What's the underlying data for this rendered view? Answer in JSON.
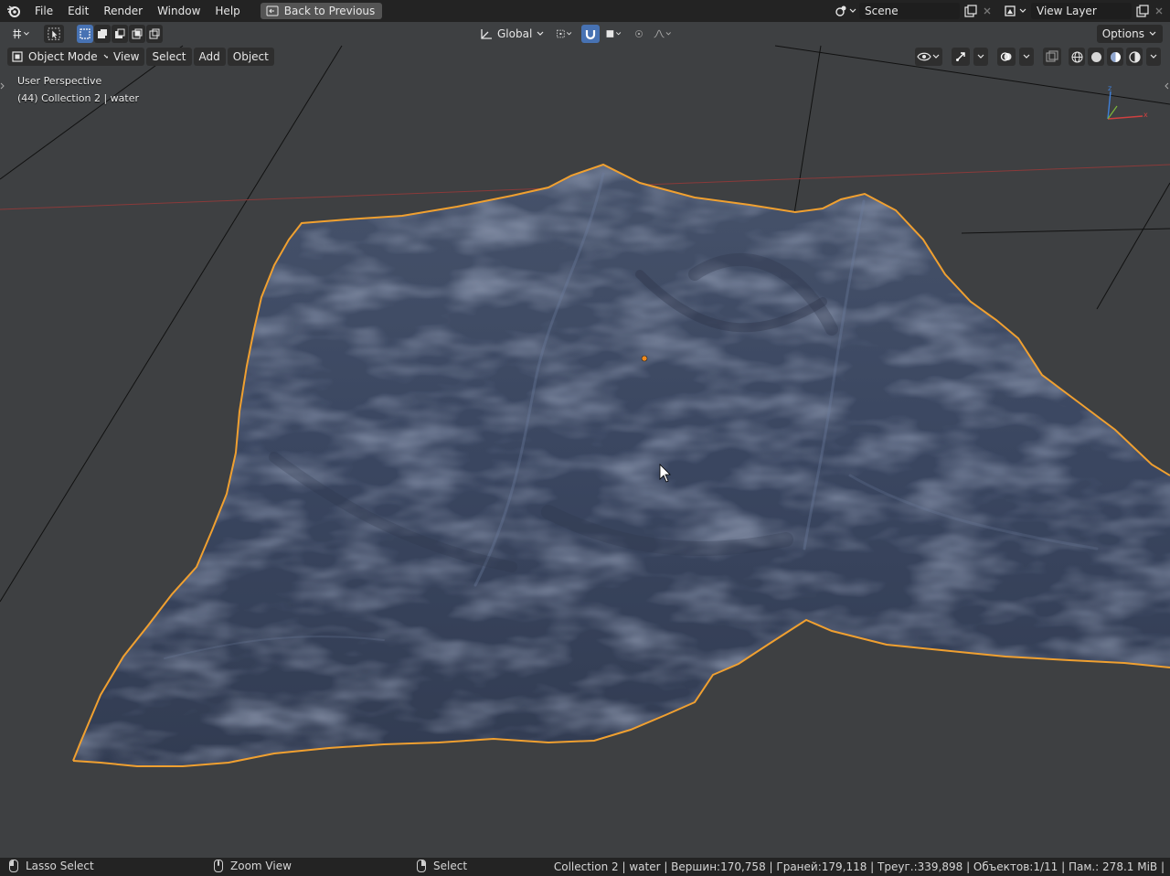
{
  "topbar": {
    "menu": [
      "File",
      "Edit",
      "Render",
      "Window",
      "Help"
    ],
    "back_button": "Back to Previous",
    "scene_name": "Scene",
    "view_layer_name": "View Layer"
  },
  "tool_header": {
    "transform_orientation": "Global",
    "options_label": "Options"
  },
  "view_header": {
    "mode": "Object Mode",
    "menus": [
      "View",
      "Select",
      "Add",
      "Object"
    ]
  },
  "viewport": {
    "perspective_label": "User Perspective",
    "collection_label": "(44) Collection 2 | water",
    "gizmo_axes": {
      "x": "x",
      "z": "z"
    },
    "colors": {
      "background": "#3e4042",
      "selection_outline": "#f0a030",
      "mesh": "#39445a",
      "origin": "#f08a1c"
    }
  },
  "statusbar": {
    "hints": [
      {
        "icon": "mouse-left-icon",
        "label": "Lasso Select"
      },
      {
        "icon": "mouse-middle-icon",
        "label": "Zoom View"
      },
      {
        "icon": "mouse-right-icon",
        "label": "Select"
      }
    ],
    "stats": "Collection 2 | water | Вершин:170,758 | Граней:179,118 | Треуг.:339,898 | Объектов:1/11 | Пам.: 278.1 MiB |"
  }
}
